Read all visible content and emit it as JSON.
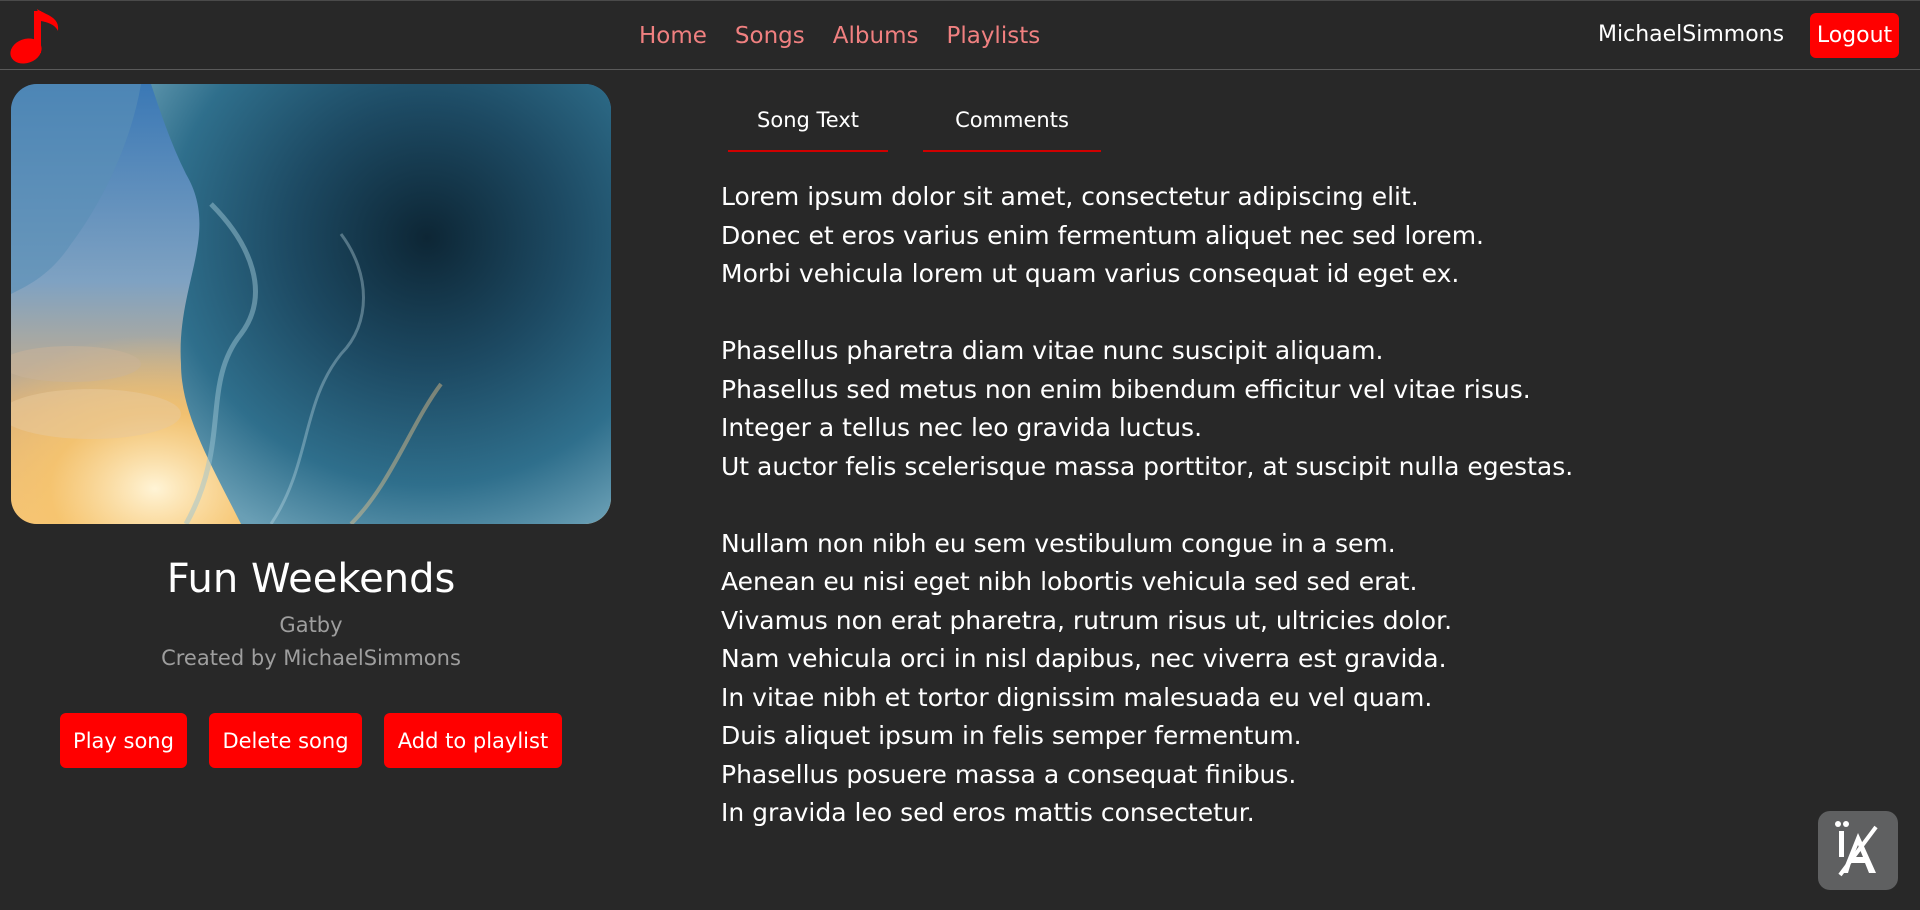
{
  "nav": {
    "links": [
      "Home",
      "Songs",
      "Albums",
      "Playlists"
    ],
    "username": "MichaelSimmons",
    "logout_label": "Logout"
  },
  "song": {
    "title": "Fun Weekends",
    "artist": "Gatby",
    "creator": "Created by MichaelSimmons",
    "actions": {
      "play": "Play song",
      "delete": "Delete song",
      "add_to_playlist": "Add to playlist"
    }
  },
  "tabs": [
    "Song Text",
    "Comments"
  ],
  "lyrics": {
    "stanzas": [
      [
        "Lorem ipsum dolor sit amet, consectetur adipiscing elit.",
        "Donec et eros varius enim fermentum aliquet nec sed lorem.",
        "Morbi vehicula lorem ut quam varius consequat id eget ex."
      ],
      [
        "Phasellus pharetra diam vitae nunc suscipit aliquam.",
        "Phasellus sed metus non enim bibendum efficitur vel vitae risus.",
        "Integer a tellus nec leo gravida luctus.",
        "Ut auctor felis scelerisque massa porttitor, at suscipit nulla egestas."
      ],
      [
        "Nullam non nibh eu sem vestibulum congue in a sem.",
        "Aenean eu nisi eget nibh lobortis vehicula sed sed erat.",
        "Vivamus non erat pharetra, rutrum risus ut, ultricies dolor.",
        "Nam vehicula orci in nisl dapibus, nec viverra est gravida.",
        "In vitae nibh et tortor dignissim malesuada eu vel quam.",
        "Duis aliquet ipsum in felis semper fermentum.",
        "Phasellus posuere massa a consequat finibus.",
        "In gravida leo sed eros mattis consectetur."
      ]
    ]
  },
  "icons": {
    "logo": "music-note-icon",
    "accessibility": "accessibility-icon"
  },
  "colors": {
    "accent": "#ff0000",
    "nav_link": "#f08080",
    "background": "#282828",
    "muted_text": "#9e9e9e"
  }
}
